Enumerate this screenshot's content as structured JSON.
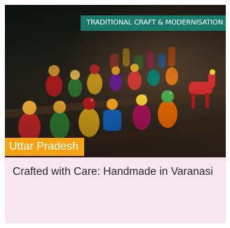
{
  "card": {
    "category": "TRADITIONAL CRAFT & MODERNISATION",
    "region": "Uttar Pradesh",
    "title": "Crafted with Care: Handmade in Varanasi",
    "image_subject": "handmade wooden toys on shelf",
    "colors": {
      "category_tag": "#1a7a6a",
      "region_badge": "#f5a315",
      "card_background": "#f7e6ee",
      "title_text": "#2b2b2b"
    }
  }
}
